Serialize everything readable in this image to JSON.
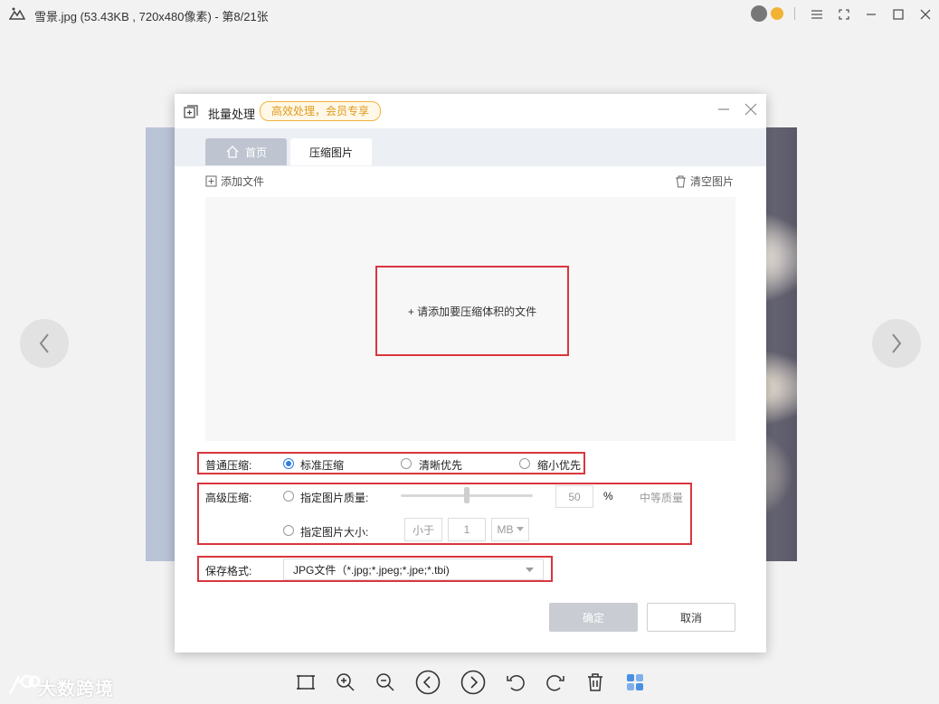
{
  "window": {
    "title": "雪景.jpg (53.43KB , 720x480像素) - 第8/21张"
  },
  "dialog": {
    "title": "批量处理",
    "badge": "高效处理，会员专享",
    "tabs": [
      {
        "label": "首页",
        "active": false
      },
      {
        "label": "压缩图片",
        "active": true
      }
    ],
    "add_file": "添加文件",
    "clear_images": "清空图片",
    "dropzone_text": "+ 请添加要压缩体积的文件",
    "normal": {
      "label": "普通压缩:",
      "options": [
        {
          "label": "标准压缩",
          "checked": true
        },
        {
          "label": "清晰优先",
          "checked": false
        },
        {
          "label": "缩小优先",
          "checked": false
        }
      ]
    },
    "advanced": {
      "label": "高级压缩:",
      "quality_label": "指定图片质量:",
      "quality_value": "50",
      "quality_percent": "%",
      "quality_level": "中等质量",
      "quality_slider_fraction": 0.5,
      "size_label": "指定图片大小:",
      "size_compare": "小于",
      "size_value": "1",
      "size_unit": "MB"
    },
    "format": {
      "label": "保存格式:",
      "value": "JPG文件（*.jpg;*.jpeg;*.jpe;*.tbi)"
    },
    "ok_label": "确定",
    "cancel_label": "取消"
  },
  "watermark": "大数跨境",
  "colors": {
    "accent": "#2f7de1",
    "highlight_box": "#d9363e",
    "badge": "#e09a1a"
  }
}
